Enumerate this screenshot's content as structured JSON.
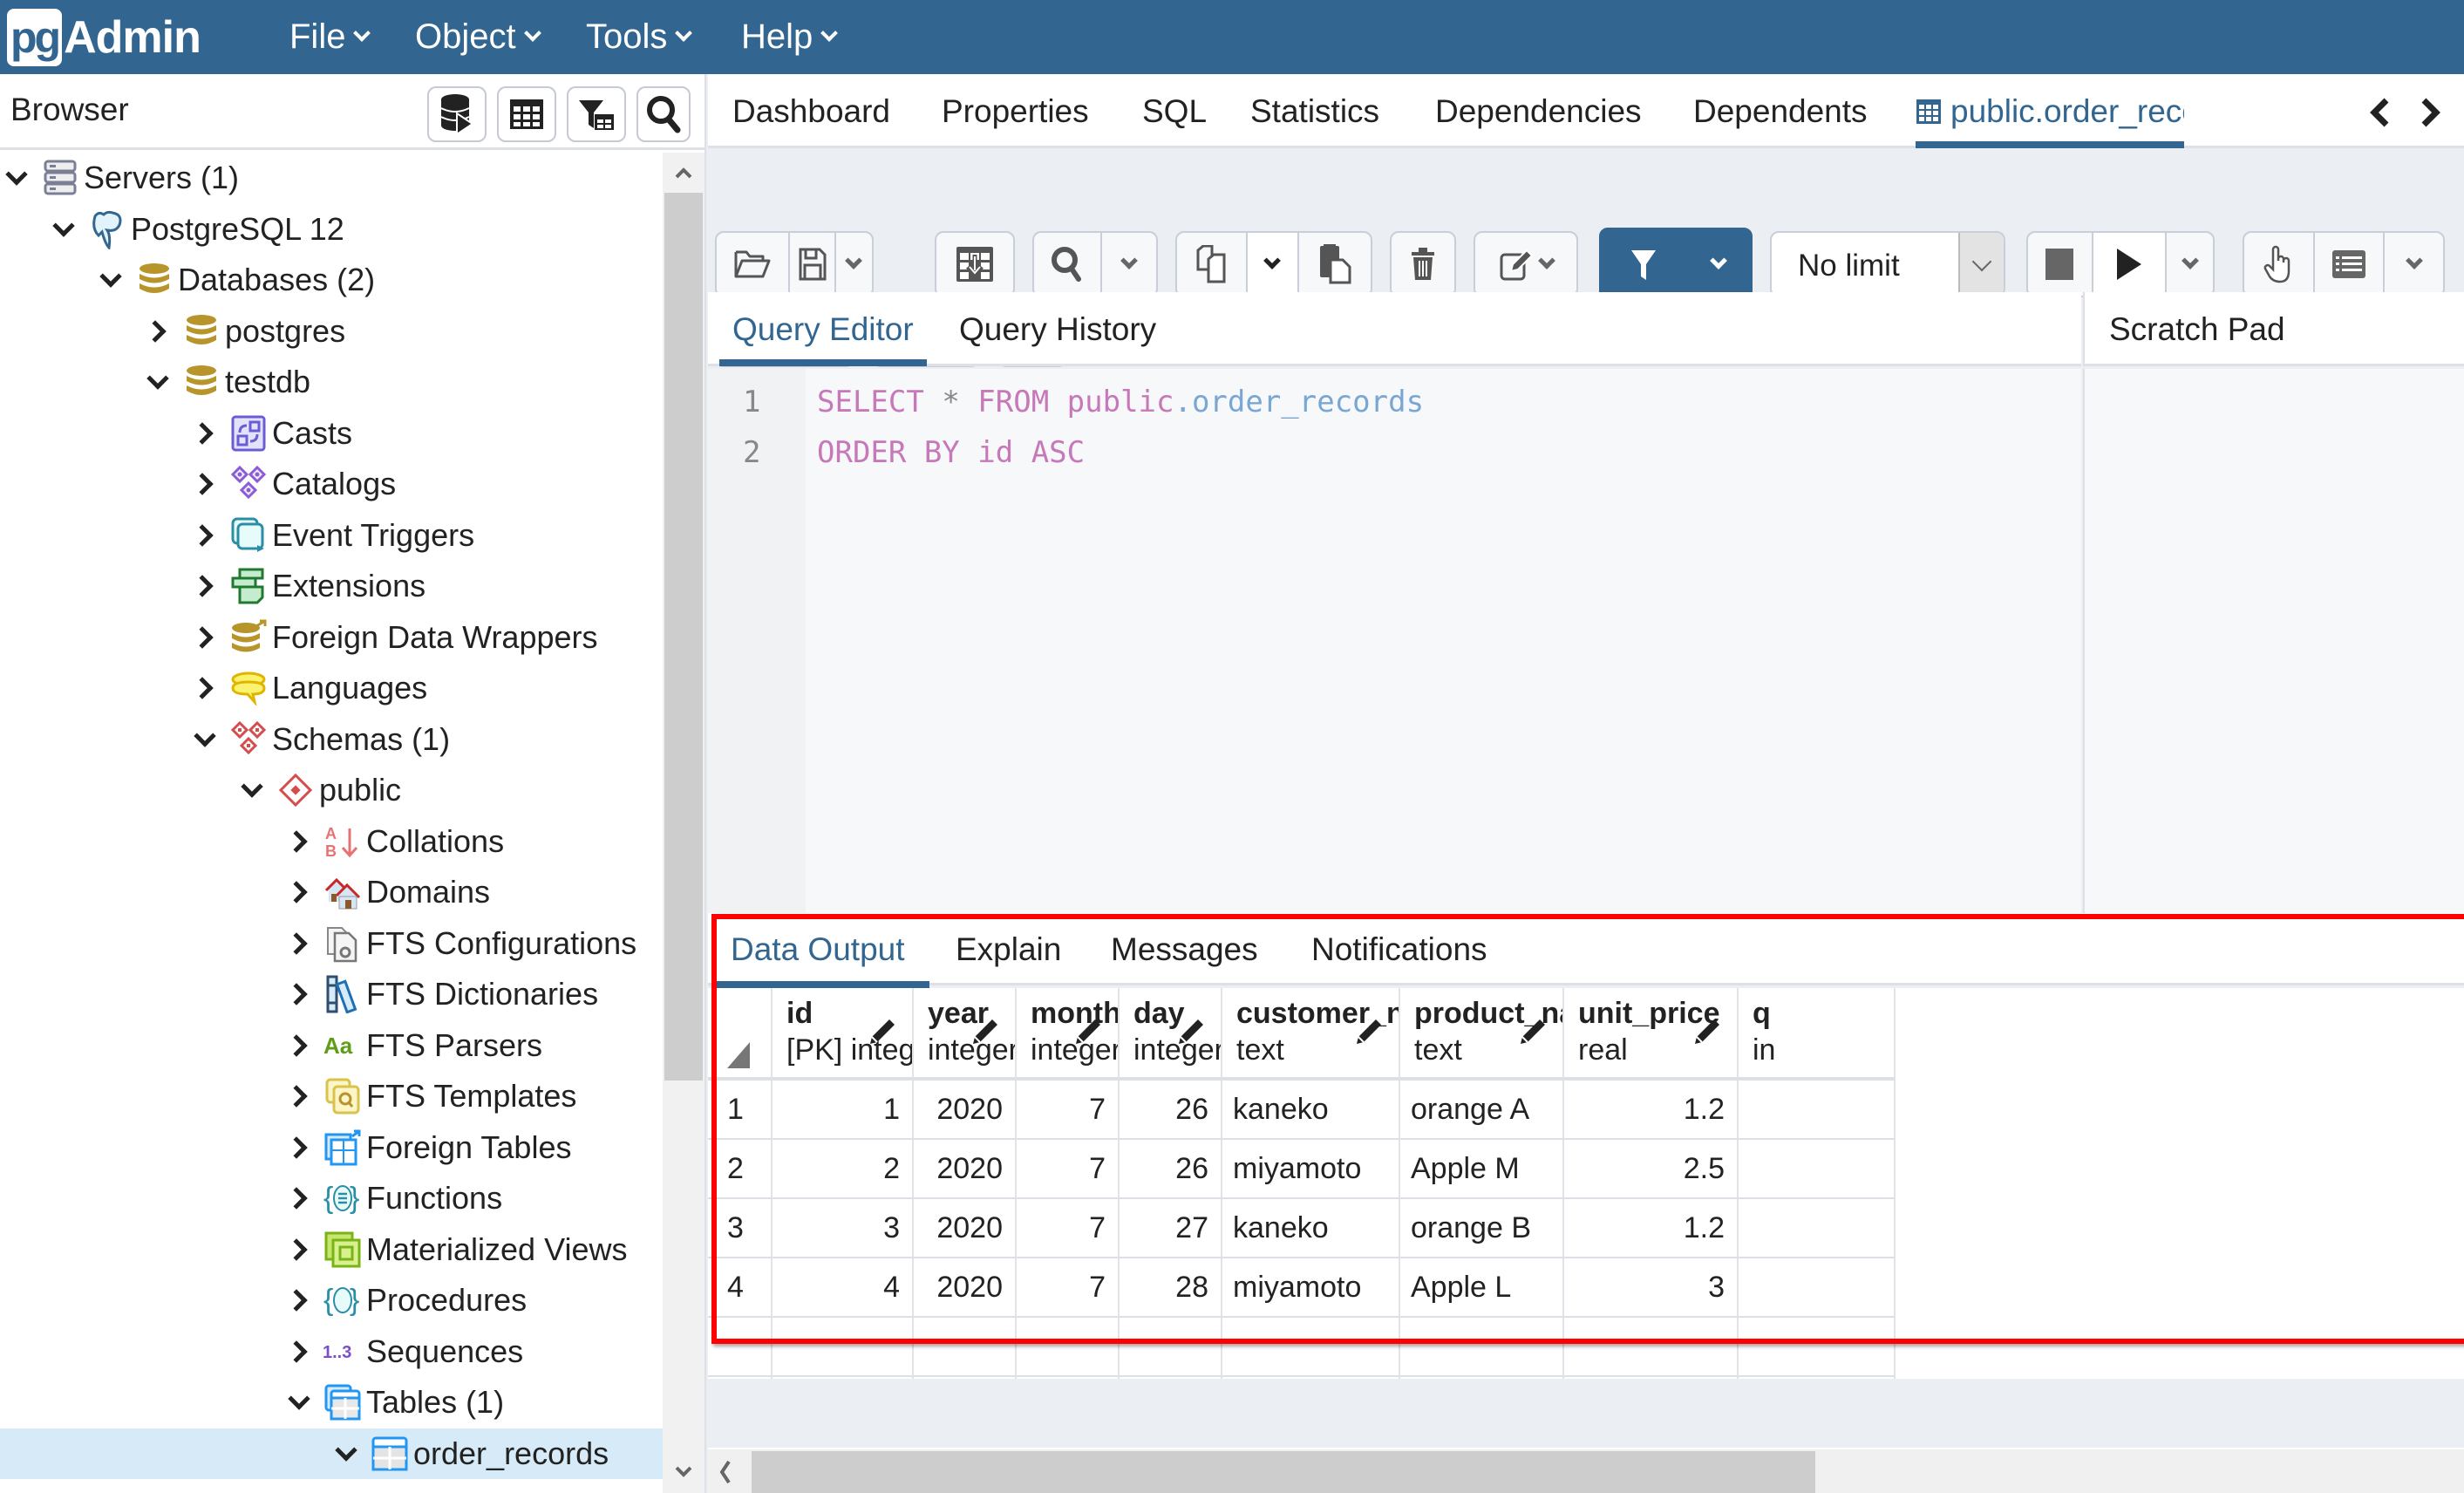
{
  "app": {
    "logo_pg": "pg",
    "logo_admin": "Admin",
    "menu": [
      {
        "label": "File"
      },
      {
        "label": "Object"
      },
      {
        "label": "Tools"
      },
      {
        "label": "Help"
      }
    ]
  },
  "browser": {
    "title": "Browser",
    "toolbar": [
      {
        "icon": "query-tool-icon"
      },
      {
        "icon": "view-data-icon"
      },
      {
        "icon": "filtered-rows-icon"
      },
      {
        "icon": "search-objects-icon"
      }
    ],
    "tree": [
      {
        "label": "Servers (1)",
        "icon": "servers-icon",
        "level": 0,
        "state": "expanded"
      },
      {
        "label": "PostgreSQL 12",
        "icon": "postgresql-elephant-icon",
        "level": 1,
        "state": "expanded"
      },
      {
        "label": "Databases (2)",
        "icon": "databases-icon",
        "level": 2,
        "state": "expanded"
      },
      {
        "label": "postgres",
        "icon": "database-icon",
        "level": 3,
        "state": "collapsed"
      },
      {
        "label": "testdb",
        "icon": "database-icon",
        "level": 3,
        "state": "expanded"
      },
      {
        "label": "Casts",
        "icon": "casts-icon",
        "level": 4,
        "state": "collapsed"
      },
      {
        "label": "Catalogs",
        "icon": "catalogs-icon",
        "level": 4,
        "state": "collapsed"
      },
      {
        "label": "Event Triggers",
        "icon": "event-triggers-icon",
        "level": 4,
        "state": "collapsed"
      },
      {
        "label": "Extensions",
        "icon": "extensions-icon",
        "level": 4,
        "state": "collapsed"
      },
      {
        "label": "Foreign Data Wrappers",
        "icon": "foreign-data-wrappers-icon",
        "level": 4,
        "state": "collapsed"
      },
      {
        "label": "Languages",
        "icon": "languages-icon",
        "level": 4,
        "state": "collapsed"
      },
      {
        "label": "Schemas (1)",
        "icon": "schemas-icon",
        "level": 4,
        "state": "expanded"
      },
      {
        "label": "public",
        "icon": "schema-icon",
        "level": 5,
        "state": "expanded"
      },
      {
        "label": "Collations",
        "icon": "collations-icon",
        "level": 6,
        "state": "collapsed"
      },
      {
        "label": "Domains",
        "icon": "domains-icon",
        "level": 6,
        "state": "collapsed"
      },
      {
        "label": "FTS Configurations",
        "icon": "fts-configurations-icon",
        "level": 6,
        "state": "collapsed"
      },
      {
        "label": "FTS Dictionaries",
        "icon": "fts-dictionaries-icon",
        "level": 6,
        "state": "collapsed"
      },
      {
        "label": "FTS Parsers",
        "icon": "fts-parsers-icon",
        "level": 6,
        "state": "collapsed"
      },
      {
        "label": "FTS Templates",
        "icon": "fts-templates-icon",
        "level": 6,
        "state": "collapsed"
      },
      {
        "label": "Foreign Tables",
        "icon": "foreign-tables-icon",
        "level": 6,
        "state": "collapsed"
      },
      {
        "label": "Functions",
        "icon": "functions-icon",
        "level": 6,
        "state": "collapsed"
      },
      {
        "label": "Materialized Views",
        "icon": "materialized-views-icon",
        "level": 6,
        "state": "collapsed"
      },
      {
        "label": "Procedures",
        "icon": "procedures-icon",
        "level": 6,
        "state": "collapsed"
      },
      {
        "label": "Sequences",
        "icon": "sequences-icon",
        "level": 6,
        "state": "collapsed"
      },
      {
        "label": "Tables (1)",
        "icon": "tables-icon",
        "level": 6,
        "state": "expanded"
      },
      {
        "label": "order_records",
        "icon": "table-icon",
        "level": 7,
        "state": "expanded",
        "selected": true
      }
    ]
  },
  "main": {
    "tabs": [
      {
        "label": "Dashboard"
      },
      {
        "label": "Properties"
      },
      {
        "label": "SQL"
      },
      {
        "label": "Statistics"
      },
      {
        "label": "Dependencies"
      },
      {
        "label": "Dependents"
      },
      {
        "label": "public.order_records/testd",
        "active": true,
        "icon": "table-icon"
      }
    ],
    "toolbar": {
      "limit_value": "No limit",
      "buttons": [
        "open-file",
        "save-file",
        "save-dropdown",
        "edit-data",
        "find",
        "find-dropdown",
        "copy",
        "copy-dropdown",
        "paste-row",
        "delete-row",
        "edit-filter",
        "edit-filter-dropdown",
        "filter",
        "filter-dropdown",
        "limit-select",
        "cancel-query",
        "execute",
        "execute-dropdown",
        "explain",
        "explain-analyze",
        "explain-dropdown",
        "commit",
        "rollback",
        "clear",
        "clear-dropdown",
        "download-csv"
      ]
    },
    "editor_tabs": [
      {
        "label": "Query Editor",
        "active": true
      },
      {
        "label": "Query History"
      }
    ],
    "scratch_pad_title": "Scratch Pad",
    "query_lines": [
      {
        "num": "1",
        "tokens": [
          {
            "text": "SELECT",
            "cls": "kw"
          },
          {
            "text": " ",
            "cls": ""
          },
          {
            "text": "*",
            "cls": "op"
          },
          {
            "text": " ",
            "cls": ""
          },
          {
            "text": "FROM",
            "cls": "kw"
          },
          {
            "text": " ",
            "cls": ""
          },
          {
            "text": "public",
            "cls": "kw"
          },
          {
            "text": ".order_records",
            "cls": "tbl"
          }
        ]
      },
      {
        "num": "2",
        "tokens": [
          {
            "text": "ORDER BY",
            "cls": "kw"
          },
          {
            "text": " ",
            "cls": ""
          },
          {
            "text": "id",
            "cls": "kw"
          },
          {
            "text": " ",
            "cls": ""
          },
          {
            "text": "ASC",
            "cls": "kw"
          }
        ]
      }
    ],
    "output_tabs": [
      {
        "label": "Data Output",
        "active": true
      },
      {
        "label": "Explain"
      },
      {
        "label": "Messages"
      },
      {
        "label": "Notifications"
      }
    ],
    "grid": {
      "columns": [
        {
          "name": "id",
          "type": "[PK] integer",
          "align": "num"
        },
        {
          "name": "year",
          "type": "integer",
          "align": "num"
        },
        {
          "name": "month",
          "type": "integer",
          "align": "num"
        },
        {
          "name": "day",
          "type": "integer",
          "align": "num"
        },
        {
          "name": "customer_name",
          "type": "text",
          "align": "txt"
        },
        {
          "name": "product_name",
          "type": "text",
          "align": "txt"
        },
        {
          "name": "unit_price",
          "type": "real",
          "align": "num"
        },
        {
          "name": "q",
          "type": "in",
          "align": "num"
        }
      ],
      "rows": [
        {
          "row_num": "1",
          "cells": [
            "1",
            "2020",
            "7",
            "26",
            "kaneko",
            "orange A",
            "1.2",
            ""
          ]
        },
        {
          "row_num": "2",
          "cells": [
            "2",
            "2020",
            "7",
            "26",
            "miyamoto",
            "Apple M",
            "2.5",
            ""
          ]
        },
        {
          "row_num": "3",
          "cells": [
            "3",
            "2020",
            "7",
            "27",
            "kaneko",
            "orange B",
            "1.2",
            ""
          ]
        },
        {
          "row_num": "4",
          "cells": [
            "4",
            "2020",
            "7",
            "28",
            "miyamoto",
            "Apple L",
            "3",
            ""
          ]
        }
      ]
    },
    "highlight_color": "#ff0000",
    "brand_color": "#326690"
  }
}
